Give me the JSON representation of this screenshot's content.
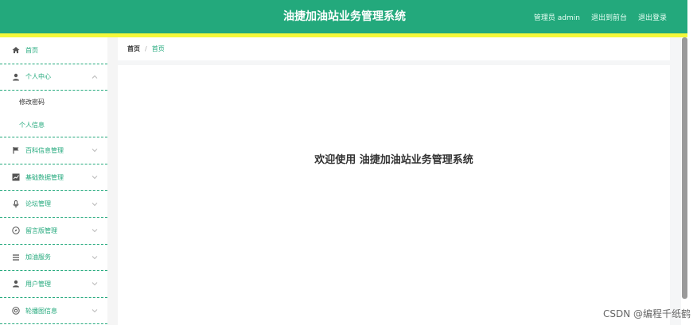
{
  "header": {
    "title": "油捷加油站业务管理系统",
    "user_label": "管理员 admin",
    "front_link": "退出到前台",
    "logout_link": "退出登录"
  },
  "sidebar": {
    "items": [
      {
        "label": "首页",
        "icon": "home-icon"
      },
      {
        "label": "个人中心",
        "icon": "user-icon",
        "expanded": true,
        "children": [
          {
            "label": "修改密码",
            "active": false
          },
          {
            "label": "个人信息",
            "active": true
          }
        ]
      },
      {
        "label": "百科信息管理",
        "icon": "flag-icon"
      },
      {
        "label": "基础数据管理",
        "icon": "chart-icon"
      },
      {
        "label": "论坛管理",
        "icon": "mic-icon"
      },
      {
        "label": "留言版管理",
        "icon": "compass-icon"
      },
      {
        "label": "加油服务",
        "icon": "list-icon"
      },
      {
        "label": "用户管理",
        "icon": "user-icon"
      },
      {
        "label": "轮播图信息",
        "icon": "settings-icon"
      }
    ]
  },
  "breadcrumb": {
    "root": "首页",
    "separator": "/",
    "current": "首页"
  },
  "main": {
    "welcome": "欢迎使用 油捷加油站业务管理系统"
  },
  "watermark": "CSDN @编程千纸鹤",
  "colors": {
    "primary": "#23a97c",
    "accent": "#f4f83a"
  }
}
